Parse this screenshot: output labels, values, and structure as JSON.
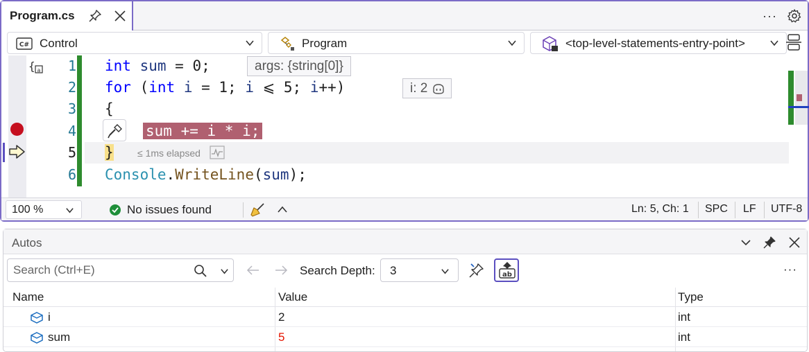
{
  "tab": {
    "title": "Program.cs"
  },
  "navbar": {
    "project": "Control",
    "type": "Program",
    "member": "<top-level-statements-entry-point>"
  },
  "code": {
    "line_numbers": [
      "1",
      "2",
      "3",
      "4",
      "5",
      "6"
    ],
    "line1": {
      "kw_int": "int",
      "id_sum": "sum",
      "rest": " = 0;"
    },
    "line2": {
      "kw_for": "for",
      "p1": " (",
      "kw_int": "int",
      "id_i": "i",
      "p2": " = 1; ",
      "id_i2": "i",
      "p3": " ⩽ 5; ",
      "id_i3": "i",
      "p4": "++)"
    },
    "line3": "{",
    "line4": "sum += i * i;",
    "line5": "}",
    "line6": {
      "ty": "Console",
      "dot": ".",
      "method": "WriteLine",
      "p1": "(",
      "id_sum": "sum",
      "p2": ");"
    }
  },
  "hints": {
    "args": "args: {string[0]}",
    "loop_var": "i: 2",
    "elapsed": "≤ 1ms elapsed"
  },
  "statusbar": {
    "zoom": "100 %",
    "issues": "No issues found",
    "position": "Ln: 5, Ch: 1",
    "whitespace": "SPC",
    "line_ending": "LF",
    "encoding": "UTF-8"
  },
  "autos": {
    "title": "Autos",
    "search_placeholder": "Search (Ctrl+E)",
    "depth_label": "Search Depth:",
    "depth_value": "3",
    "columns": [
      "Name",
      "Value",
      "Type"
    ],
    "rows": [
      {
        "name": "i",
        "value": "2",
        "type": "int",
        "changed": false
      },
      {
        "name": "sum",
        "value": "5",
        "type": "int",
        "changed": true
      }
    ]
  },
  "colors": {
    "accent": "#7b6bc7",
    "changed_value": "#e51400",
    "breakpoint": "#c50f1f",
    "highlight": "#b06070"
  }
}
